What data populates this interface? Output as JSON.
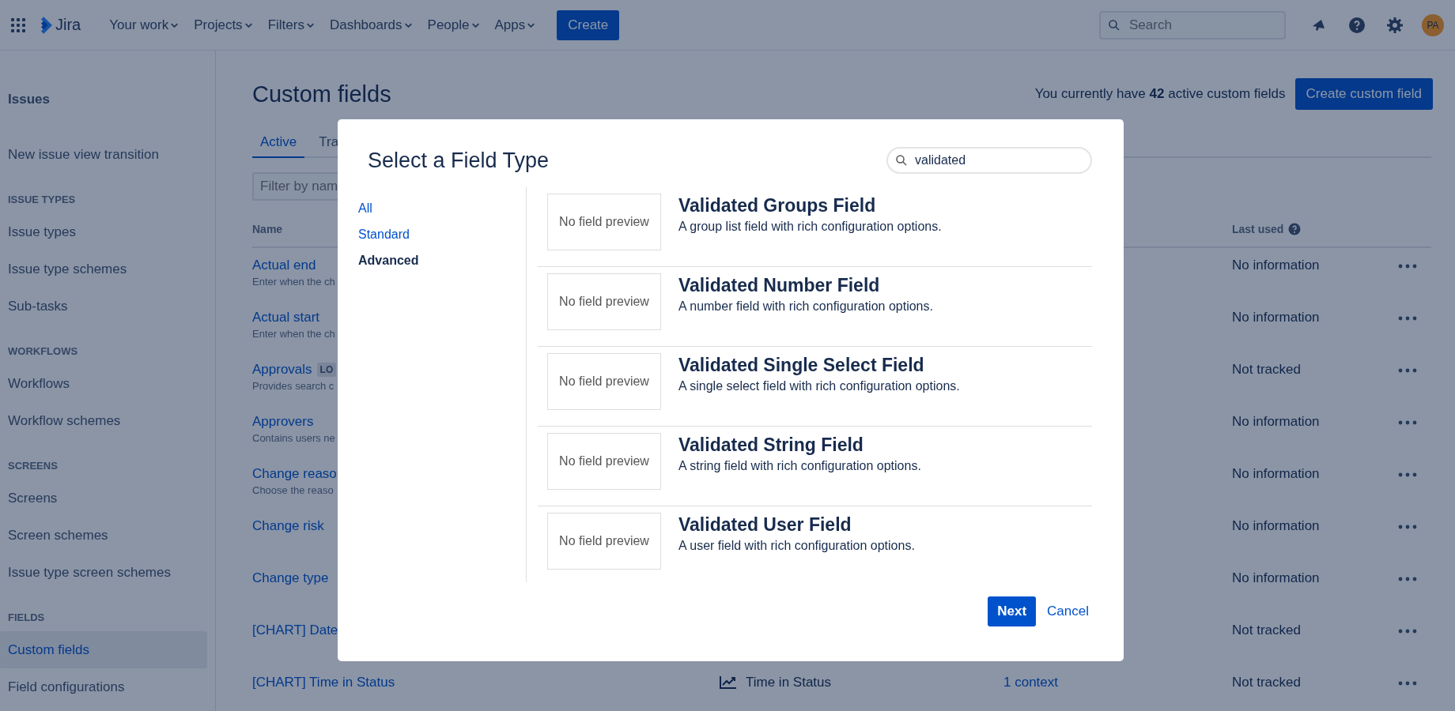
{
  "nav": {
    "logo": "Jira",
    "menus": [
      {
        "label": "Your work"
      },
      {
        "label": "Projects"
      },
      {
        "label": "Filters"
      },
      {
        "label": "Dashboards"
      },
      {
        "label": "People"
      },
      {
        "label": "Apps"
      }
    ],
    "create": "Create",
    "search": {
      "placeholder": "Search"
    },
    "avatar": "PA"
  },
  "sidebar": {
    "title": "Issues",
    "items": [
      {
        "kind": "link",
        "label": "New issue view transition",
        "selected": false
      },
      {
        "kind": "heading",
        "label": "ISSUE TYPES"
      },
      {
        "kind": "link",
        "label": "Issue types",
        "selected": false
      },
      {
        "kind": "link",
        "label": "Issue type schemes",
        "selected": false
      },
      {
        "kind": "link",
        "label": "Sub-tasks",
        "selected": false
      },
      {
        "kind": "heading",
        "label": "WORKFLOWS"
      },
      {
        "kind": "link",
        "label": "Workflows",
        "selected": false
      },
      {
        "kind": "link",
        "label": "Workflow schemes",
        "selected": false
      },
      {
        "kind": "heading",
        "label": "SCREENS"
      },
      {
        "kind": "link",
        "label": "Screens",
        "selected": false
      },
      {
        "kind": "link",
        "label": "Screen schemes",
        "selected": false
      },
      {
        "kind": "link",
        "label": "Issue type screen schemes",
        "selected": false
      },
      {
        "kind": "heading",
        "label": "FIELDS"
      },
      {
        "kind": "link",
        "label": "Custom fields",
        "selected": true
      },
      {
        "kind": "link",
        "label": "Field configurations",
        "selected": false
      }
    ]
  },
  "page": {
    "title": "Custom fields",
    "summary": "You currently have **42** active custom fields",
    "create_button": "Create custom field",
    "tabs": [
      {
        "label": "Active",
        "selected": true
      },
      {
        "label": "Tra",
        "selected": false
      }
    ],
    "filter": {
      "placeholder": "Filter by nam"
    },
    "table": {
      "columns": [
        "Name",
        "Last used"
      ],
      "rows": [
        {
          "name": "Actual end",
          "description": "Enter when the ch",
          "last_used": "No information"
        },
        {
          "name": "Actual start",
          "description": "Enter when the ch",
          "last_used": "No information"
        },
        {
          "name": "Approvals",
          "badge": "LO",
          "description": "Provides search c",
          "last_used": "Not tracked"
        },
        {
          "name": "Approvers",
          "description": "Contains users ne",
          "last_used": "No information"
        },
        {
          "name": "Change reaso",
          "description": "Choose the reaso",
          "last_used": "No information"
        },
        {
          "name": "Change risk",
          "last_used": "No information"
        },
        {
          "name": "Change type",
          "last_used": "No information"
        },
        {
          "name": "[CHART] Date",
          "last_used": "Not tracked"
        },
        {
          "name": "[CHART] Time in Status",
          "type": "Time in Status",
          "contexts": "1 context",
          "last_used": "Not tracked"
        }
      ]
    }
  },
  "dialog": {
    "title": "Select a Field Type",
    "search": {
      "value": "validated"
    },
    "categories": [
      {
        "label": "All",
        "selected": false
      },
      {
        "label": "Standard",
        "selected": false
      },
      {
        "label": "Advanced",
        "selected": true
      }
    ],
    "field_types": [
      {
        "title": "Validated Groups Field",
        "description": "A group list field with rich configuration options.",
        "preview": "No field preview"
      },
      {
        "title": "Validated Number Field",
        "description": "A number field with rich configuration options.",
        "preview": "No field preview"
      },
      {
        "title": "Validated Single Select Field",
        "description": "A single select field with rich configuration options.",
        "preview": "No field preview"
      },
      {
        "title": "Validated String Field",
        "description": "A string field with rich configuration options.",
        "preview": "No field preview"
      },
      {
        "title": "Validated User Field",
        "description": "A user field with rich configuration options.",
        "preview": "No field preview"
      }
    ],
    "buttons": {
      "primary": "Next",
      "secondary": "Cancel"
    }
  }
}
